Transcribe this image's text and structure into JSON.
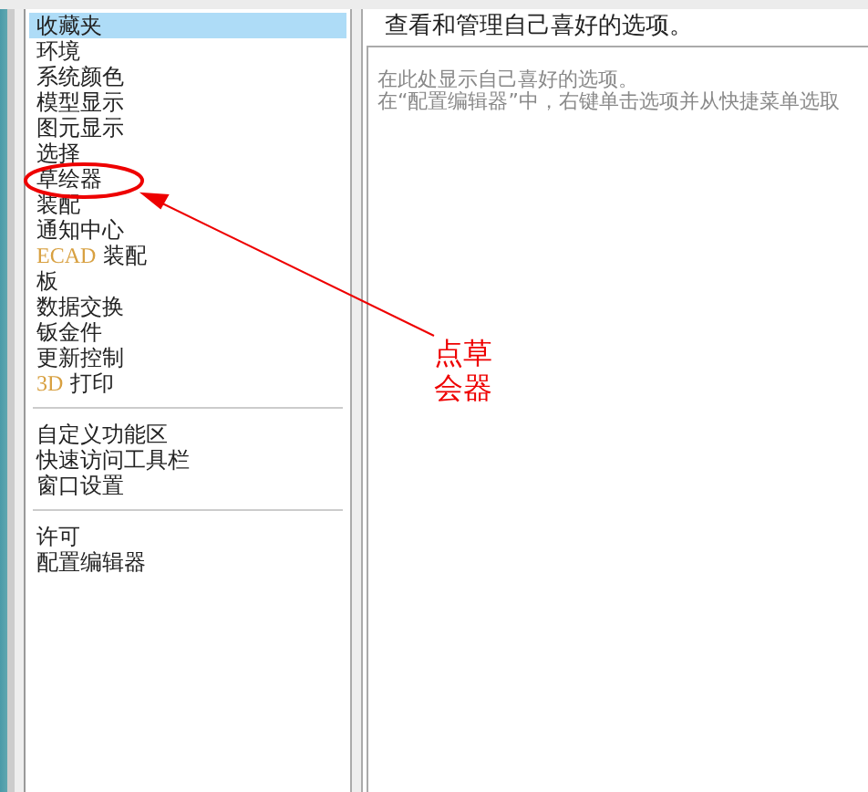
{
  "sidebar": {
    "groups": [
      {
        "items": [
          {
            "label": "收藏夹",
            "selected": true
          },
          {
            "label": "环境",
            "selected": false
          },
          {
            "label": "系统颜色",
            "selected": false
          },
          {
            "label": "模型显示",
            "selected": false
          },
          {
            "label": "图元显示",
            "selected": false
          },
          {
            "label": "选择",
            "selected": false
          },
          {
            "label": "草绘器",
            "selected": false
          },
          {
            "label": "装配",
            "selected": false
          },
          {
            "label": "通知中心",
            "selected": false
          },
          {
            "label": "装配",
            "prefix": "ECAD",
            "selected": false
          },
          {
            "label": "板",
            "selected": false
          },
          {
            "label": "数据交换",
            "selected": false
          },
          {
            "label": "钣金件",
            "selected": false
          },
          {
            "label": "更新控制",
            "selected": false
          },
          {
            "label": "打印",
            "prefix": "3D",
            "selected": false
          }
        ]
      },
      {
        "items": [
          {
            "label": "自定义功能区",
            "selected": false
          },
          {
            "label": "快速访问工具栏",
            "selected": false
          },
          {
            "label": "窗口设置",
            "selected": false
          }
        ]
      },
      {
        "items": [
          {
            "label": "许可",
            "selected": false
          },
          {
            "label": "配置编辑器",
            "selected": false
          }
        ]
      }
    ]
  },
  "panel": {
    "heading": "查看和管理自己喜好的选项。",
    "lines": [
      "在此处显示自己喜好的选项。",
      "在“配置编辑器”中，右键单击选项并从快捷菜单选取"
    ]
  },
  "annotation": {
    "lines": [
      "点草",
      "会器"
    ]
  }
}
